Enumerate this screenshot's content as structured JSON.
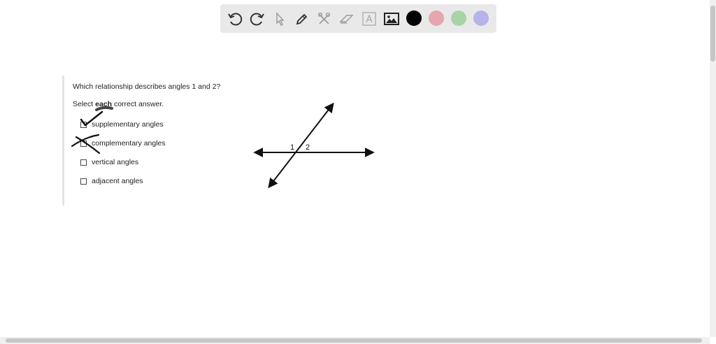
{
  "toolbar": {
    "tools": [
      {
        "name": "undo",
        "icon": "undo-icon"
      },
      {
        "name": "redo",
        "icon": "redo-icon"
      },
      {
        "name": "select",
        "icon": "pointer-icon"
      },
      {
        "name": "pen",
        "icon": "pen-icon"
      },
      {
        "name": "tools",
        "icon": "tools-icon"
      },
      {
        "name": "eraser",
        "icon": "eraser-icon"
      },
      {
        "name": "text",
        "icon": "text-icon"
      },
      {
        "name": "image",
        "icon": "image-icon"
      }
    ],
    "colors": [
      "#000000",
      "#e6a6ae",
      "#a9d3a7",
      "#b5b3ea"
    ]
  },
  "question": {
    "prompt": "Which relationship describes angles 1 and 2?",
    "instruction_prefix": "Select ",
    "instruction_emphasis": "each",
    "instruction_suffix": " correct answer.",
    "options": [
      "supplementary angles",
      "complementary angles",
      "vertical angles",
      "adjacent angles"
    ]
  },
  "diagram": {
    "angle_label_1": "1",
    "angle_label_2": "2"
  },
  "annotations": {
    "checkmark_on": "supplementary angles",
    "crossed_out": "complementary angles"
  }
}
